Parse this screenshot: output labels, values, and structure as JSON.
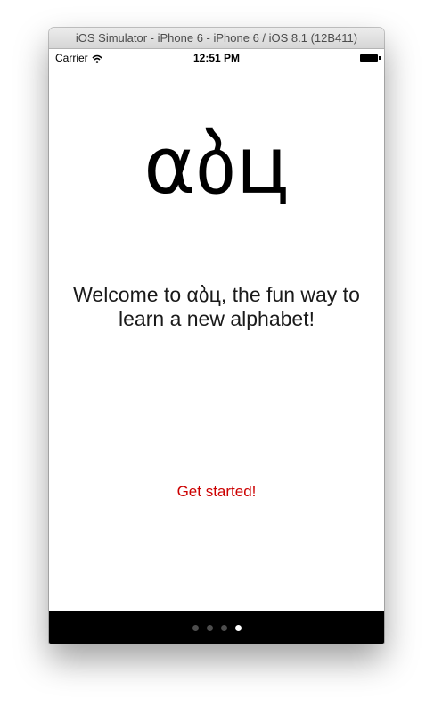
{
  "window": {
    "title": "iOS Simulator - iPhone 6 - iPhone 6 / iOS 8.1 (12B411)"
  },
  "status_bar": {
    "carrier": "Carrier",
    "time": "12:51 PM",
    "icons": [
      "wifi-icon",
      "battery-icon"
    ]
  },
  "screen": {
    "logo_text": "αბц",
    "welcome_text": "Welcome to αბц, the fun way to learn a new alphabet!",
    "cta_label": "Get started!"
  },
  "page_control": {
    "count": 4,
    "current_index": 3
  },
  "colors": {
    "accent": "#cc0000",
    "page_bar": "#000000",
    "inactive_dot": "#4d4d4d",
    "active_dot": "#ffffff"
  }
}
